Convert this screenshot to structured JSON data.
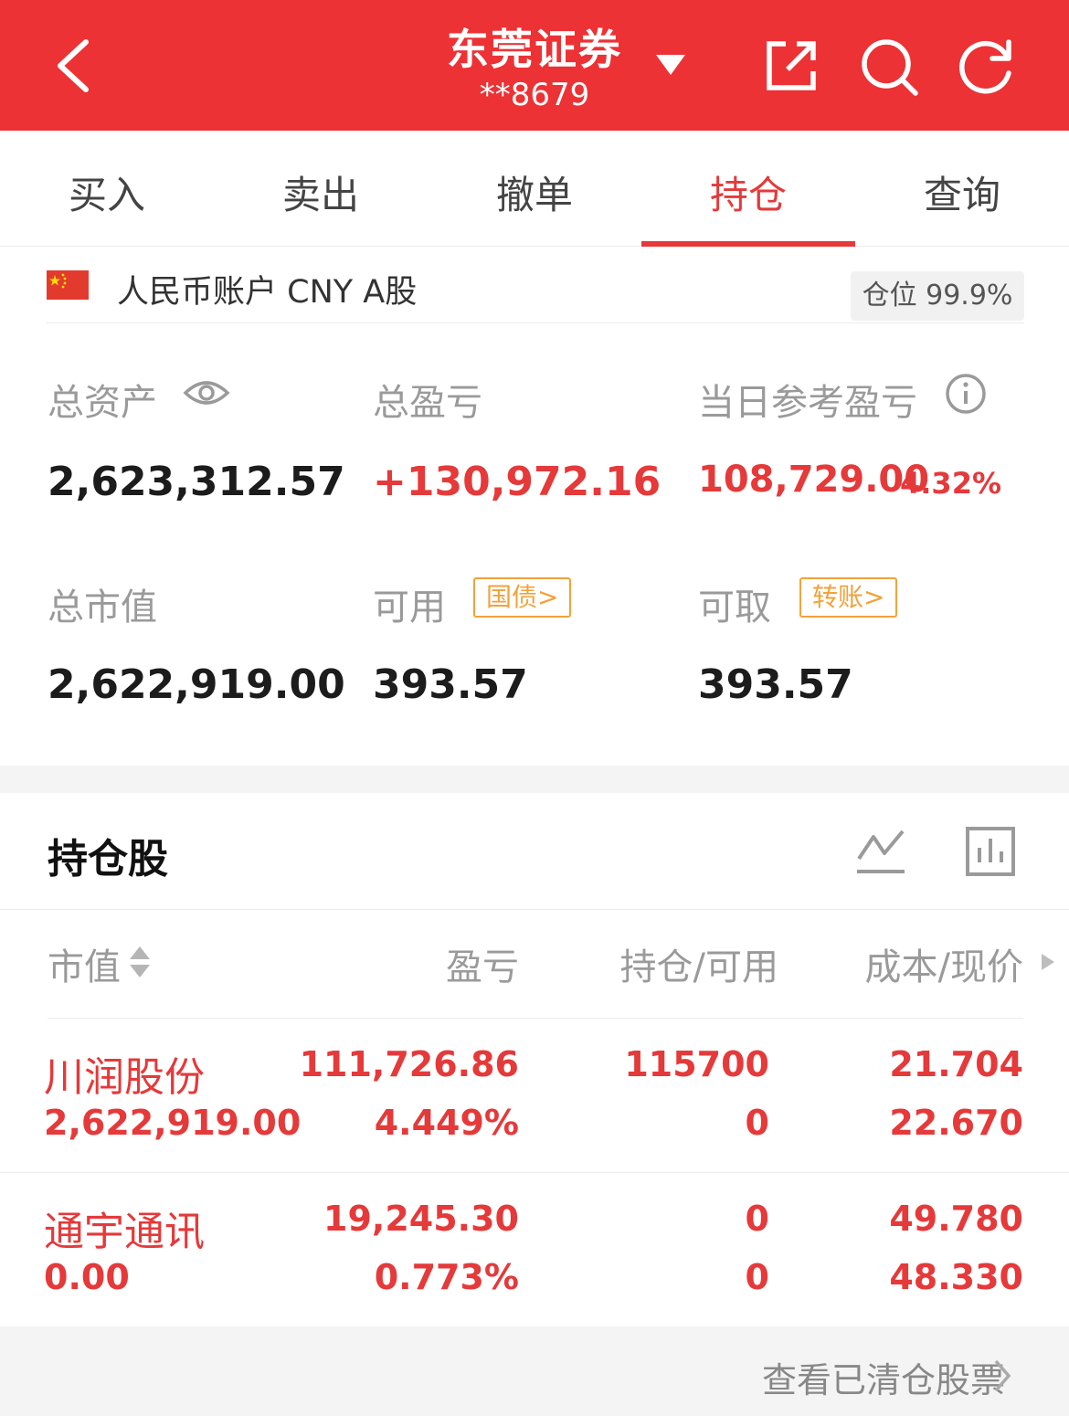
{
  "header": {
    "broker_name": "东莞证券",
    "account_mask": "**8679",
    "icons": [
      "back-icon",
      "dropdown-icon",
      "share-icon",
      "search-icon",
      "refresh-icon"
    ]
  },
  "tabs": [
    {
      "label": "买入"
    },
    {
      "label": "卖出"
    },
    {
      "label": "撤单"
    },
    {
      "label": "持仓",
      "active": true
    },
    {
      "label": "查询"
    }
  ],
  "account": {
    "label": "人民币账户 CNY A股",
    "position_ratio": "仓位 99.9%"
  },
  "summary": {
    "total_assets_label": "总资产",
    "total_assets": "2,623,312.57",
    "total_pl_label": "总盈亏",
    "total_pl": "+130,972.16",
    "daily_pl_label": "当日参考盈亏",
    "daily_pl": "108,729.00",
    "daily_pl_pct": "4.32%",
    "market_value_label": "总市值",
    "market_value": "2,622,919.00",
    "available_label": "可用",
    "available_tag": "国债>",
    "available": "393.57",
    "withdrawable_label": "可取",
    "withdrawable_tag": "转账>",
    "withdrawable": "393.57"
  },
  "holdings": {
    "title": "持仓股",
    "columns": [
      "市值",
      "盈亏",
      "持仓/可用",
      "成本/现价"
    ],
    "rows": [
      {
        "name": "川润股份",
        "market_value": "2,622,919.00",
        "pl": "111,726.86",
        "pl_pct": "4.449%",
        "position": "115700",
        "available": "0",
        "cost": "21.704",
        "price": "22.670"
      },
      {
        "name": "通宇通讯",
        "market_value": "0.00",
        "pl": "19,245.30",
        "pl_pct": "0.773%",
        "position": "0",
        "available": "0",
        "cost": "49.780",
        "price": "48.330"
      }
    ]
  },
  "footer": {
    "link": "查看已清仓股票"
  },
  "colors": {
    "brand_red": "#ec3235",
    "profit_red": "#e5393a",
    "tag_orange": "#f2a23a"
  }
}
